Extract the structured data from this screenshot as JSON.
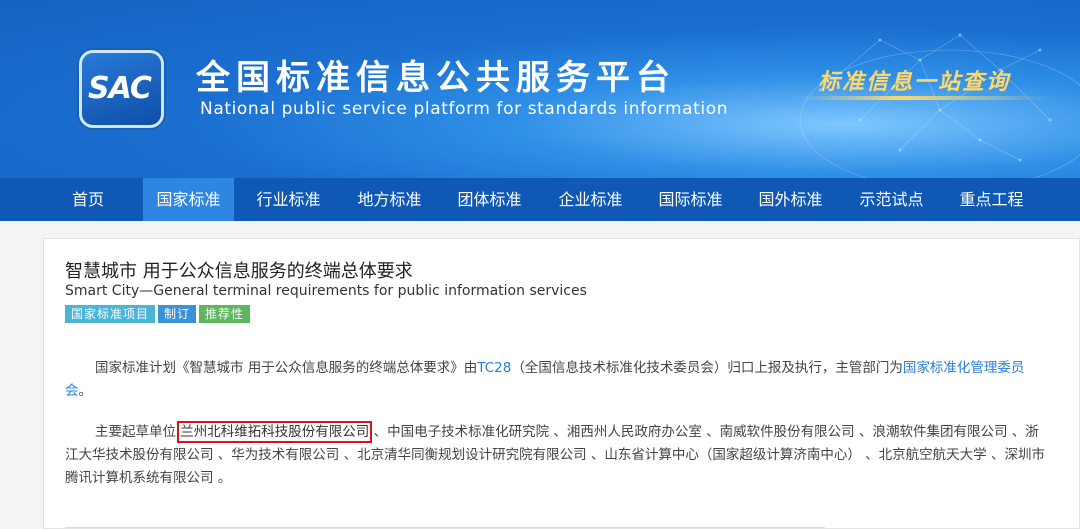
{
  "header": {
    "logo_text": "SAC",
    "site_title": "全国标准信息公共服务平台",
    "site_subtitle": "National public service platform  for standards information",
    "slogan": "标准信息一站查询"
  },
  "nav": {
    "items": [
      {
        "label": "首页"
      },
      {
        "label": "国家标准",
        "active": true
      },
      {
        "label": "行业标准"
      },
      {
        "label": "地方标准"
      },
      {
        "label": "团体标准"
      },
      {
        "label": "企业标准"
      },
      {
        "label": "国际标准"
      },
      {
        "label": "国外标准"
      },
      {
        "label": "示范试点"
      },
      {
        "label": "重点工程"
      }
    ]
  },
  "standard": {
    "title": "智慧城市 用于公众信息服务的终端总体要求",
    "title_en": "Smart City—General terminal requirements for public information services",
    "tags": [
      "国家标准项目",
      "制订",
      "推荐性"
    ],
    "plan": {
      "prefix": "国家标准计划《智慧城市 用于公众信息服务的终端总体要求》由",
      "tc_link": "TC28",
      "middle": "（全国信息技术标准化技术委员会）归口上报及执行，主管部门为",
      "dept_link": "国家标准化管理委员会",
      "suffix": "。"
    },
    "drafters": {
      "prefix": "主要起草单位 ",
      "highlighted": "兰州北科维拓科技股份有限公司",
      "rest": " 、中国电子技术标准化研究院 、湘西州人民政府办公室 、南威软件股份有限公司 、浪潮软件集团有限公司 、浙江大华技术股份有限公司 、华为技术有限公司 、北京清华同衡规划设计研究院有限公司 、山东省计算中心（国家超级计算济南中心） 、北京航空航天大学 、深圳市腾讯计算机系统有限公司 。"
    }
  },
  "colors": {
    "banner": "#1a6fd0",
    "nav": "#0f58b3",
    "nav_active": "#2f86e0",
    "link": "#2b7fd4",
    "highlight_box": "#d9141b"
  }
}
